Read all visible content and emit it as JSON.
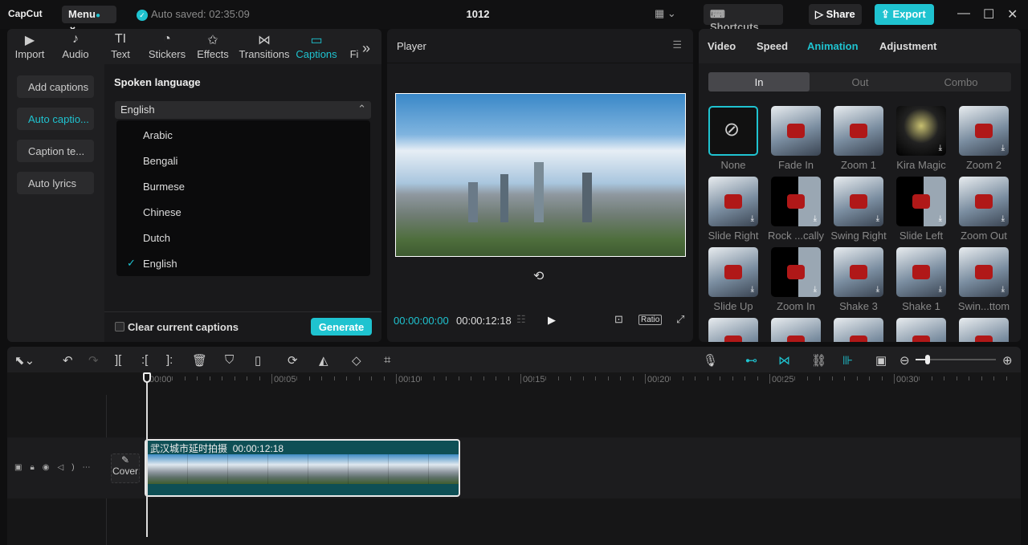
{
  "titlebar": {
    "app": "CapCut",
    "menu": "Menu",
    "auto_saved": "Auto saved: 02:35:09",
    "project": "1012",
    "shortcuts": "Shortcuts",
    "share": "Share",
    "export": "Export"
  },
  "media_tabs": [
    {
      "label": "Import",
      "icon": "import-icon"
    },
    {
      "label": "Audio",
      "icon": "audio-icon"
    },
    {
      "label": "Text",
      "icon": "text-icon"
    },
    {
      "label": "Stickers",
      "icon": "stickers-icon"
    },
    {
      "label": "Effects",
      "icon": "effects-icon"
    },
    {
      "label": "Transitions",
      "icon": "transitions-icon"
    },
    {
      "label": "Captions",
      "icon": "captions-icon",
      "active": true
    },
    {
      "label": "Fi",
      "icon": "filters-icon"
    }
  ],
  "captions_sidebar": [
    "Add captions",
    "Auto captio...",
    "Caption te...",
    "Auto lyrics"
  ],
  "captions": {
    "spoken_language_label": "Spoken language",
    "selected": "English",
    "options": [
      "Arabic",
      "Bengali",
      "Burmese",
      "Chinese",
      "Dutch",
      "English"
    ],
    "clear_label": "Clear current captions",
    "generate": "Generate"
  },
  "player": {
    "title": "Player",
    "current_time": "00:00:00:00",
    "duration": "00:00:12:18",
    "ratio": "Ratio"
  },
  "inspector": {
    "tabs": [
      "Video",
      "Speed",
      "Animation",
      "Adjustment"
    ],
    "active_tab": "Animation",
    "subtabs": [
      "In",
      "Out",
      "Combo"
    ],
    "active_subtab": "In",
    "animations": [
      "None",
      "Fade In",
      "Zoom 1",
      "Kira Magic",
      "Zoom 2",
      "Slide Right",
      "Rock ...cally",
      "Swing Right",
      "Slide Left",
      "Zoom Out",
      "Slide Up",
      "Zoom In",
      "Shake 3",
      "Shake 1",
      "Swin...ttom"
    ]
  },
  "timeline": {
    "ruler": [
      "00:00",
      "00:05",
      "00:10",
      "00:15",
      "00:20",
      "00:25",
      "00:30"
    ],
    "clip_title": "武汉城市延时拍摄",
    "clip_duration": "00:00:12:18",
    "cover": "Cover"
  },
  "colors": {
    "accent": "#1fc3d0",
    "clip": "#0e4f55"
  }
}
